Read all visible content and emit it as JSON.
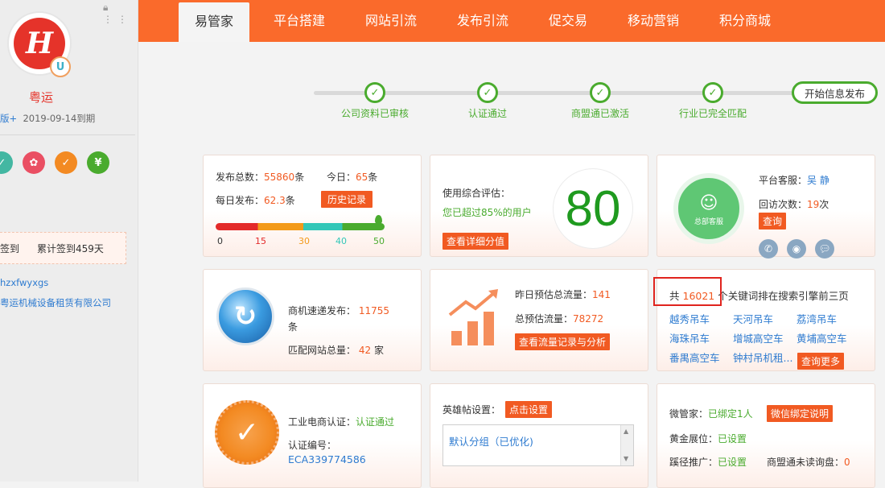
{
  "sidebar": {
    "company_name": "粤运",
    "version_label": "版+",
    "expiry": "2019-09-14到期",
    "badges": [
      {
        "icon": "shield-icon",
        "glyph": "✓",
        "color": "#43b7a2"
      },
      {
        "icon": "award-icon",
        "glyph": "✿",
        "color": "#ea4f63"
      },
      {
        "icon": "medal-icon",
        "glyph": "✓",
        "color": "#f38a22"
      },
      {
        "icon": "yen-icon",
        "glyph": "¥",
        "color": "#4aab2e"
      }
    ],
    "sign_label": "签到",
    "sign_total": "累计签到459天",
    "domain": "hzxfwyxgs",
    "full_name": "粤运机械设备租赁有限公司"
  },
  "nav": {
    "tabs": [
      "易管家",
      "平台搭建",
      "网站引流",
      "发布引流",
      "促交易",
      "移动营销",
      "积分商城"
    ],
    "active_index": 0
  },
  "progress": {
    "steps": [
      "公司资料已审核",
      "认证通过",
      "商盟通已激活",
      "行业已完全匹配"
    ],
    "start_button": "开始信息发布"
  },
  "publish": {
    "total_label": "发布总数：",
    "total_value": "55860",
    "total_unit": "条",
    "today_label": "今日：",
    "today_value": "65",
    "today_unit": "条",
    "daily_label": "每日发布：",
    "daily_value": "62.3",
    "daily_unit": "条",
    "history_button": "历史记录",
    "gauge_ticks": [
      "0",
      "15",
      "30",
      "40",
      "50"
    ],
    "gauge_level": 1.0
  },
  "score": {
    "label": "使用综合评估：",
    "exceed_text": "您已超过85%的用户",
    "value": "80",
    "detail_button": "查看详细分值"
  },
  "service": {
    "circle_label": "总部客服",
    "staff_label": "平台客服：",
    "staff_name": "吴 静",
    "visits_label": "回访次数：",
    "visits_value": "19",
    "visits_unit": "次",
    "query_button": "查询"
  },
  "shangji": {
    "publish_label": "商机速递发布：",
    "publish_value": "11755",
    "publish_unit": "条",
    "sites_label": "匹配网站总量：",
    "sites_value": "42",
    "sites_unit": "家"
  },
  "traffic": {
    "yesterday_label": "昨日预估总流量：",
    "yesterday_value": "141",
    "total_label": "总预估流量：",
    "total_value": "78272",
    "analysis_button": "查看流量记录与分析"
  },
  "keywords": {
    "prefix": "共",
    "count": "16021",
    "suffix": "个关键词排在搜索引擎前三页",
    "items": [
      "越秀吊车",
      "天河吊车",
      "荔湾吊车",
      "海珠吊车",
      "增城高空车",
      "黄埔高空车",
      "番禺高空车",
      "钟村吊机租..."
    ],
    "more_button": "查询更多"
  },
  "cert": {
    "label": "工业电商认证：",
    "status": "认证通过",
    "number_label": "认证编号：",
    "number": "ECA339774586"
  },
  "hero": {
    "label": "英雄帖设置：",
    "set_button": "点击设置",
    "list_item": "默认分组（已优化)"
  },
  "wechat": {
    "label": "微管家：",
    "value": "已绑定1人",
    "explain_button": "微信绑定说明",
    "gold_label": "黄金展位：",
    "gold_value": "已设置",
    "shortcut_label": "蹊径推广：",
    "shortcut_value": "已设置",
    "unread_label": "商盟通未读询盘：",
    "unread_value": "0"
  }
}
